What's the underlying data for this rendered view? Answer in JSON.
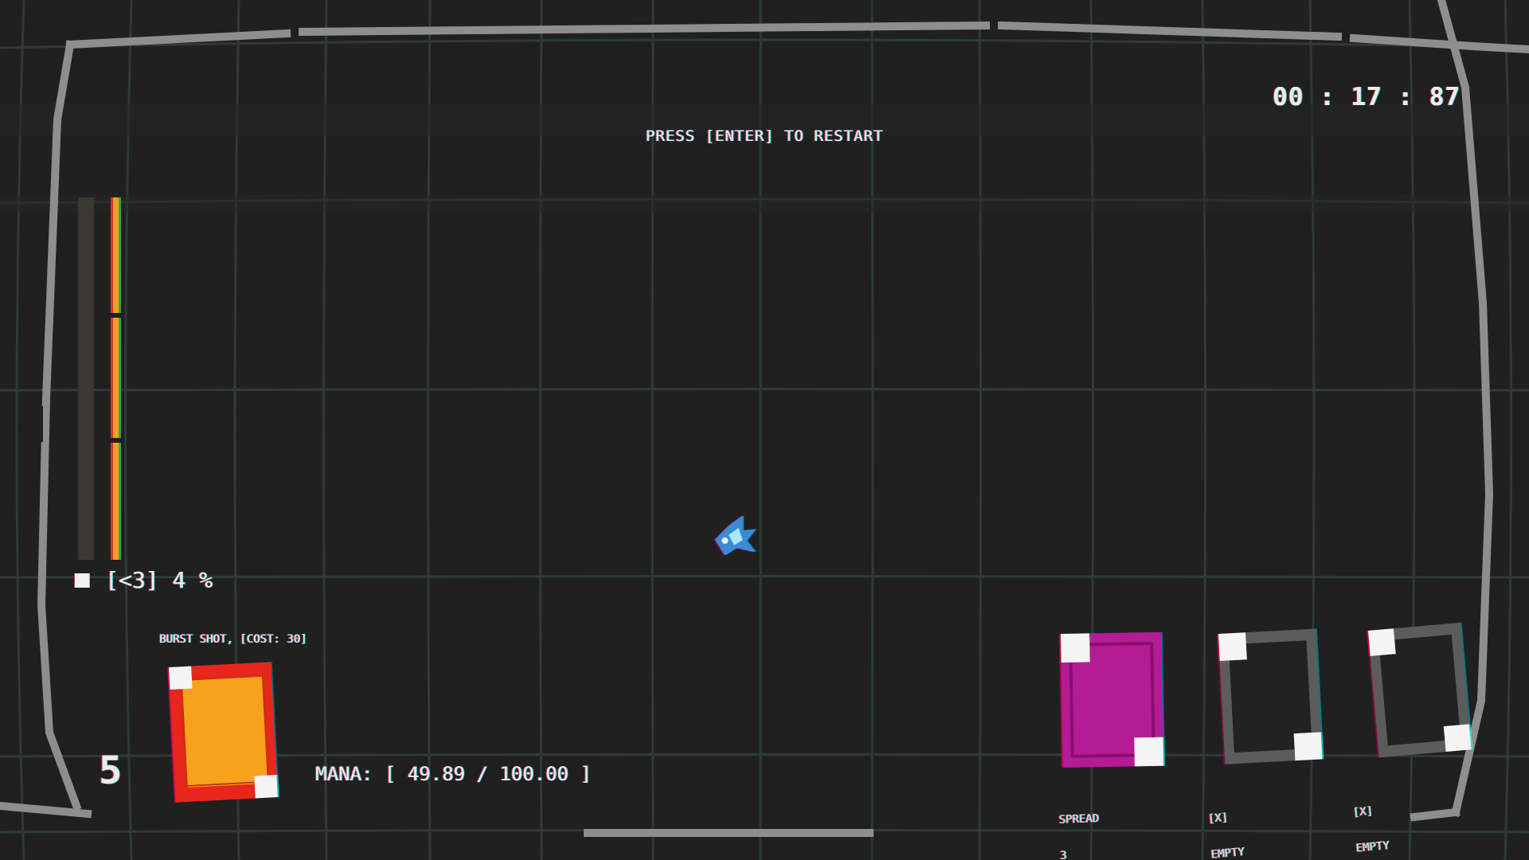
{
  "hud": {
    "restart_prompt": "PRESS [ENTER] TO RESTART",
    "timer": "00 : 17 : 87",
    "health_text": "[<3] 4 %",
    "health_fraction": 0.04,
    "level": "5",
    "mana_text": "MANA: [ 49.89 / 100.00 ]",
    "mana_current": 49.89,
    "mana_max": 100.0
  },
  "active_spell": {
    "description": "BURST SHOT, [COST: 30]",
    "card_color": "#f6a21e",
    "card_border_color": "#e8281e"
  },
  "spell_slots": [
    {
      "line1": "SPREAD",
      "line2": "3",
      "card_color": "#b31e94"
    },
    {
      "line1": "[X]",
      "line2": "EMPTY",
      "card_color": "#2a2a2a"
    },
    {
      "line1": "[X]",
      "line2": "EMPTY",
      "card_color": "#2a2a2a"
    }
  ],
  "colors": {
    "background": "#202020",
    "grid_line": "#2d3b38",
    "frame": "#8a8a8a",
    "health_bar": "#f0a020",
    "player": "#3a8ad8"
  }
}
